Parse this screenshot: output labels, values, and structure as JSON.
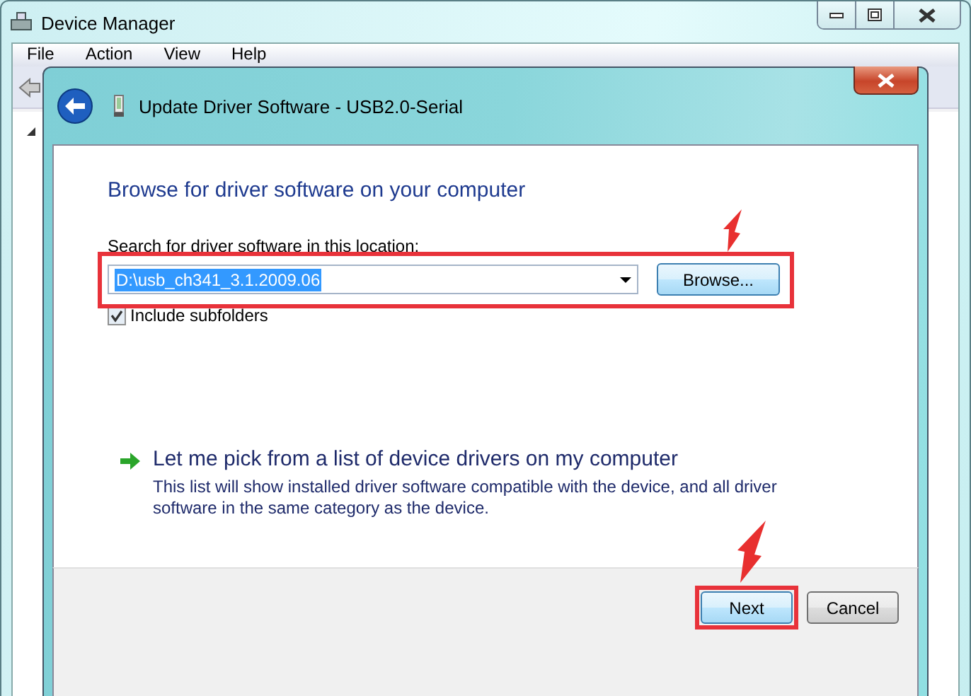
{
  "window": {
    "title": "Device Manager",
    "menu": [
      "File",
      "Action",
      "View",
      "Help"
    ]
  },
  "dialog": {
    "title": "Update Driver Software - USB2.0-Serial",
    "heading": "Browse for driver software on your computer",
    "location_label": "Search for driver software in this location:",
    "location": {
      "value": "D:\\usb_ch341_3.1.2009.06",
      "selected": true
    },
    "browse_button": "Browse...",
    "include_subfolders": {
      "label": "Include subfolders",
      "checked": true
    },
    "pick_link": {
      "title": "Let me pick from a list of device drivers on my computer",
      "description": "This list will show installed driver software compatible with the device, and all driver software in the same category as the device."
    },
    "buttons": [
      {
        "label": "Next",
        "default": true
      },
      {
        "label": "Cancel",
        "default": false
      }
    ]
  }
}
